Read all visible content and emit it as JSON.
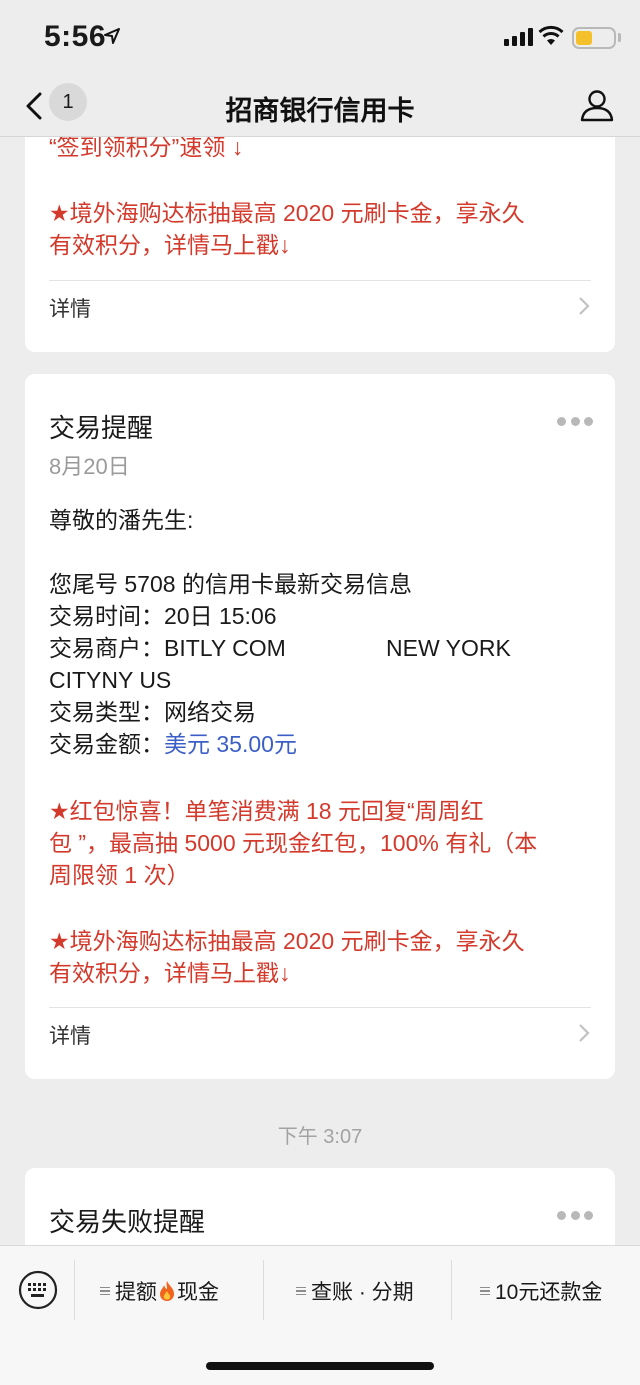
{
  "status_bar": {
    "time": "5:56",
    "battery_level": 0.45,
    "battery_color": "#f4c12a"
  },
  "nav": {
    "badge_count": "1",
    "title": "招商银行信用卡"
  },
  "cards": {
    "first": {
      "partial_line": "“签到领积分”速领 ↓",
      "promo_lines": [
        "★境外海购达标抽最高 2020 元刷卡金，享永久",
        "有效积分，详情马上戳↓"
      ],
      "detail_label": "详情"
    },
    "second": {
      "title": "交易提醒",
      "date": "8月20日",
      "greeting": "尊敬的潘先生:",
      "intro": "您尾号 5708 的信用卡最新交易信息",
      "time_label": "交易时间：",
      "time_value": "20日 15:06",
      "merchant_label": "交易商户：",
      "merchant_value": "BITLY COM",
      "merchant_city": "NEW YORK",
      "merchant_line2": "CITYNY US",
      "type_label": "交易类型：",
      "type_value": "网络交易",
      "amount_label": "交易金额：",
      "amount_value": "美元 35.00元",
      "promo1_lines": [
        "★红包惊喜！单笔消费满 18 元回复“周周红",
        "包 ”，最高抽 5000 元现金红包，100% 有礼（本",
        "周限领 1 次）"
      ],
      "promo2_lines": [
        "★境外海购达标抽最高 2020 元刷卡金，享永久",
        "有效积分，详情马上戳↓"
      ],
      "detail_label": "详情"
    },
    "third": {
      "title": "交易失败提醒"
    }
  },
  "timestamp": "下午 3:07",
  "bottom_menu": {
    "item1_left": "提额",
    "item1_right": "现金",
    "item2": "查账 · 分期",
    "item3": "10元还款金"
  },
  "colors": {
    "promo_red": "#d43a2c",
    "amount_blue": "#3b5fc7",
    "background": "#ededed"
  },
  "icons": [
    "location-arrow-icon",
    "signal-icon",
    "wifi-icon",
    "battery-icon",
    "back-arrow-icon",
    "profile-icon",
    "more-dots-icon",
    "chevron-right-icon",
    "keyboard-icon",
    "menu-lines-icon",
    "fire-icon"
  ]
}
